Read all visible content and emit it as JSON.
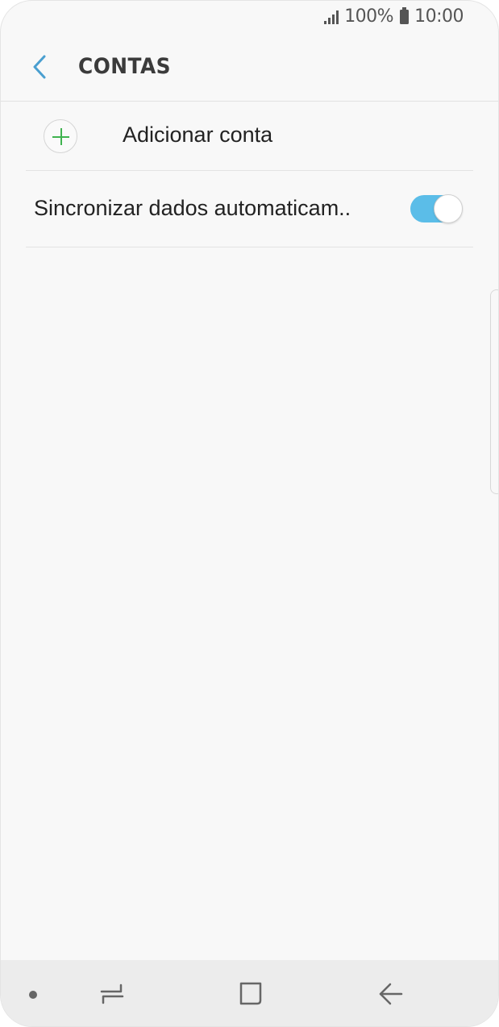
{
  "status_bar": {
    "battery_percent": "100%",
    "time": "10:00",
    "icons": [
      "signal-icon",
      "battery-icon"
    ]
  },
  "header": {
    "title": "CONTAS",
    "back_icon": "chevron-left-icon"
  },
  "accounts": {
    "add_account_label": "Adicionar conta",
    "add_icon": "plus-icon",
    "sync_label": "Sincronizar dados automaticam..",
    "sync_enabled": true
  },
  "colors": {
    "accent": "#5bbde8",
    "plus": "#3fb34f",
    "back_chevron": "#4a9fd0"
  },
  "nav_bar": {
    "icons": [
      "dot-icon",
      "recent-apps-icon",
      "home-icon",
      "back-icon"
    ]
  }
}
